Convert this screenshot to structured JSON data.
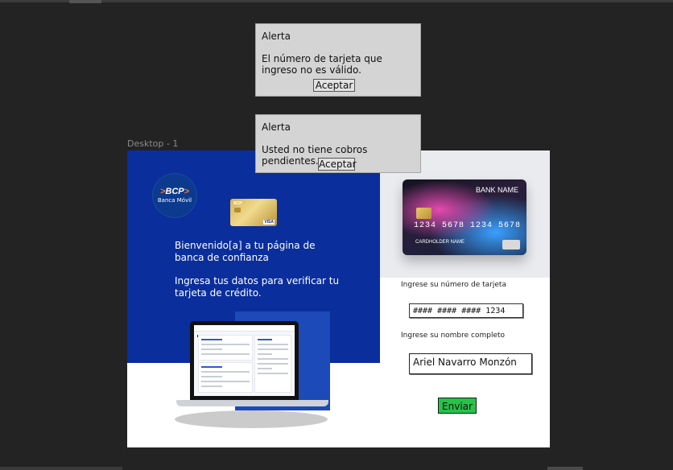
{
  "canvas": {
    "frame_label": "Desktop - 1"
  },
  "alerts": [
    {
      "title": "Alerta",
      "message": "El número de tarjeta que ingreso no es válido.",
      "button": "Aceptar"
    },
    {
      "title": "Alerta",
      "message": "Usted no tiene cobros pendientes.",
      "button": "Aceptar"
    }
  ],
  "brand": {
    "logo_text": "BCP",
    "logo_sub": "Banca Móvil"
  },
  "welcome": {
    "line1": "Bienvenido[a] a tu página de banca de confianza",
    "line2": "Ingresa tus datos para verificar tu tarjeta de crédito."
  },
  "card_preview": {
    "bank_name": "BANK NAME",
    "number": "1234 5678 1234 5678",
    "holder": "CARDHOLDER NAME"
  },
  "gold_card": {
    "brand": "BCP",
    "network": "VISA"
  },
  "form": {
    "card_label": "Ingrese su número de tarjeta",
    "card_value": "#### #### #### 1234",
    "name_label": "Ingrese su nombre completo",
    "name_value": "Ariel Navarro Monzón",
    "submit": "Enviar"
  },
  "colors": {
    "brand_blue": "#0a2e9c",
    "submit_green": "#27c24a",
    "dialog_bg": "#d4d4d4",
    "canvas_bg": "#232323"
  }
}
